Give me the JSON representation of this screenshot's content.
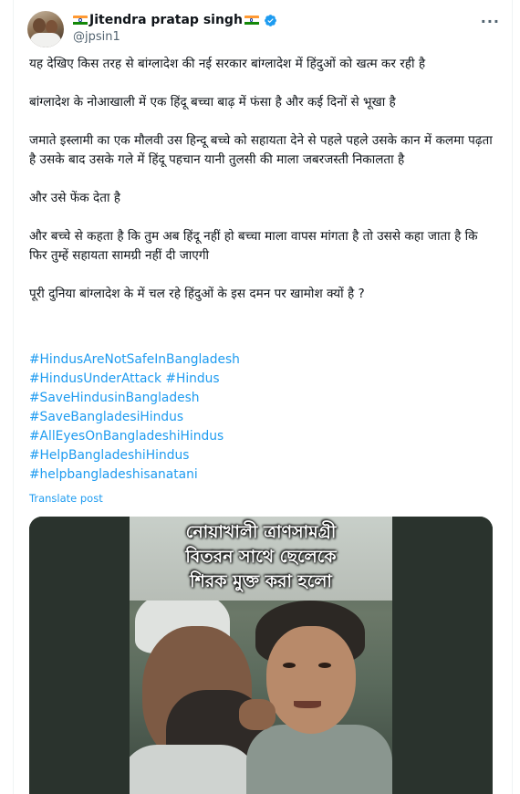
{
  "author": {
    "display_name": "Jitendra pratap singh",
    "handle": "@jpsin1",
    "verified": true,
    "avatar_icon": "avatar-photo",
    "name_prefix_icon": "india-flag-icon",
    "name_suffix_icon": "india-flag-icon"
  },
  "post": {
    "paragraphs": [
      "यह देखिए किस तरह से बांग्लादेश की नई सरकार बांग्लादेश में हिंदुओं को खत्म कर रही है",
      "बांग्लादेश के नोआखाली में एक हिंदू बच्चा बाढ़ में फंसा है और कई दिनों से भूखा है",
      " जमाते इस्लामी का एक मौलवी उस हिन्दू बच्चे  को सहायता देने से पहले पहले उसके कान में कलमा पढ़ता है उसके बाद उसके गले में हिंदू पहचान यानी तुलसी की माला जबरजस्ती निकालता है",
      "और उसे फेंक देता है",
      "और बच्चे से कहता है कि तुम अब हिंदू नहीं हो बच्चा माला वापस मांगता है तो उससे कहा जाता है कि फिर तुम्हें सहायता सामग्री नहीं दी जाएगी",
      "पूरी दुनिया बांग्लादेश के में चल रहे हिंदुओं के इस दमन पर खामोश क्यों है ?"
    ],
    "hashtag_lines": [
      "#HindusAreNotSafeInBangladesh",
      "#HindusUnderAttack #Hindus",
      "#SaveHindusinBangladesh",
      "#SaveBangladesiHindus",
      "#AllEyesOnBangladeshiHindus",
      "#HelpBangladeshiHindus",
      "#helpbangladeshisanatani"
    ],
    "translate_label": "Translate post"
  },
  "media": {
    "caption_lines": [
      "নোয়াখালী ত্রাণসামগ্রী",
      "বিতরন সাথে ছেলেকে",
      "শিরক মুক্ত করা হলো"
    ]
  },
  "colors": {
    "link": "#1d9bf0",
    "verified": "#1d9bf0",
    "text": "#0f1419",
    "secondary": "#536471"
  }
}
